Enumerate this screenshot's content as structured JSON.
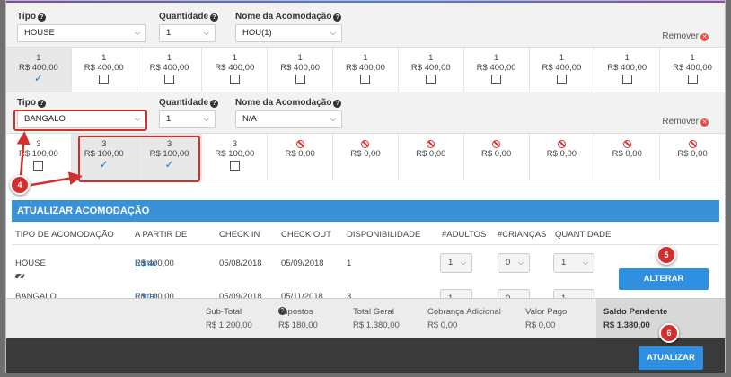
{
  "rooms": [
    {
      "labels": {
        "tipo": "Tipo",
        "quantidade": "Quantidade",
        "nome": "Nome da Acomodação"
      },
      "tipo_value": "HOUSE",
      "quantidade_value": "1",
      "nome_value": "HOU(1)",
      "remover_label": "Remover",
      "cells": [
        {
          "count": "1",
          "price": "R$ 400,00",
          "state": "checked"
        },
        {
          "count": "1",
          "price": "R$ 400,00",
          "state": "empty"
        },
        {
          "count": "1",
          "price": "R$ 400,00",
          "state": "empty"
        },
        {
          "count": "1",
          "price": "R$ 400,00",
          "state": "empty"
        },
        {
          "count": "1",
          "price": "R$ 400,00",
          "state": "empty"
        },
        {
          "count": "1",
          "price": "R$ 400,00",
          "state": "empty"
        },
        {
          "count": "1",
          "price": "R$ 400,00",
          "state": "empty"
        },
        {
          "count": "1",
          "price": "R$ 400,00",
          "state": "empty"
        },
        {
          "count": "1",
          "price": "R$ 400,00",
          "state": "empty"
        },
        {
          "count": "1",
          "price": "R$ 400,00",
          "state": "empty"
        },
        {
          "count": "1",
          "price": "R$ 400,00",
          "state": "empty"
        }
      ]
    },
    {
      "labels": {
        "tipo": "Tipo",
        "quantidade": "Quantidade",
        "nome": "Nome da Acomodação"
      },
      "tipo_value": "BANGALO",
      "quantidade_value": "1",
      "nome_value": "N/A",
      "remover_label": "Remover",
      "cells": [
        {
          "count": "3",
          "price": "R$ 100,00",
          "state": "empty"
        },
        {
          "count": "3",
          "price": "R$ 100,00",
          "state": "checked"
        },
        {
          "count": "3",
          "price": "R$ 100,00",
          "state": "checked"
        },
        {
          "count": "3",
          "price": "R$ 100,00",
          "state": "empty"
        },
        {
          "count": "",
          "price": "R$ 0,00",
          "state": "unavailable"
        },
        {
          "count": "",
          "price": "R$ 0,00",
          "state": "unavailable"
        },
        {
          "count": "",
          "price": "R$ 0,00",
          "state": "unavailable"
        },
        {
          "count": "",
          "price": "R$ 0,00",
          "state": "unavailable"
        },
        {
          "count": "",
          "price": "R$ 0,00",
          "state": "unavailable"
        },
        {
          "count": "",
          "price": "R$ 0,00",
          "state": "unavailable"
        },
        {
          "count": "",
          "price": "R$ 0,00",
          "state": "unavailable"
        }
      ]
    }
  ],
  "annotations": {
    "step4": "4",
    "step5": "5",
    "step6": "6"
  },
  "update_section": {
    "title": "ATUALIZAR ACOMODAÇÃO",
    "columns": [
      "TIPO DE ACOMODAÇÃO",
      "A PARTIR DE",
      "CHECK IN",
      "CHECK OUT",
      "DISPONIBILIDADE",
      "#ADULTOS",
      "#CRIANÇAS",
      "QUANTIDADE"
    ],
    "rows": [
      {
        "tipo": "HOUSE",
        "preco": "R$ 400,00",
        "editar": "Editar",
        "checkin": "05/08/2018",
        "checkout": "05/09/2018",
        "disp": "1",
        "adultos": "1",
        "criancas": "0",
        "quantidade": "1"
      },
      {
        "tipo": "BANGALO",
        "preco": "R$ 100,00",
        "editar": "Editar",
        "checkin": "05/09/2018",
        "checkout": "05/11/2018",
        "disp": "3",
        "adultos": "1",
        "criancas": "0",
        "quantidade": "1"
      }
    ],
    "alterar_label": "ALTERAR"
  },
  "summary": {
    "subtotal_label": "Sub-Total",
    "subtotal_value": "R$ 1.200,00",
    "impostos_label": "Impostos",
    "impostos_value": "R$ 180,00",
    "total_label": "Total Geral",
    "total_value": "R$ 1.380,00",
    "cobranca_label": "Cobrança Adicional",
    "cobranca_value": "R$ 0,00",
    "pago_label": "Valor Pago",
    "pago_value": "R$ 0,00",
    "saldo_label": "Saldo Pendente",
    "saldo_value": "R$ 1.380,00"
  },
  "footer": {
    "atualizar_label": "ATUALIZAR"
  },
  "colors": {
    "accent": "#3a92d6",
    "annotation": "#d32f2f",
    "check": "#2a78c8"
  }
}
